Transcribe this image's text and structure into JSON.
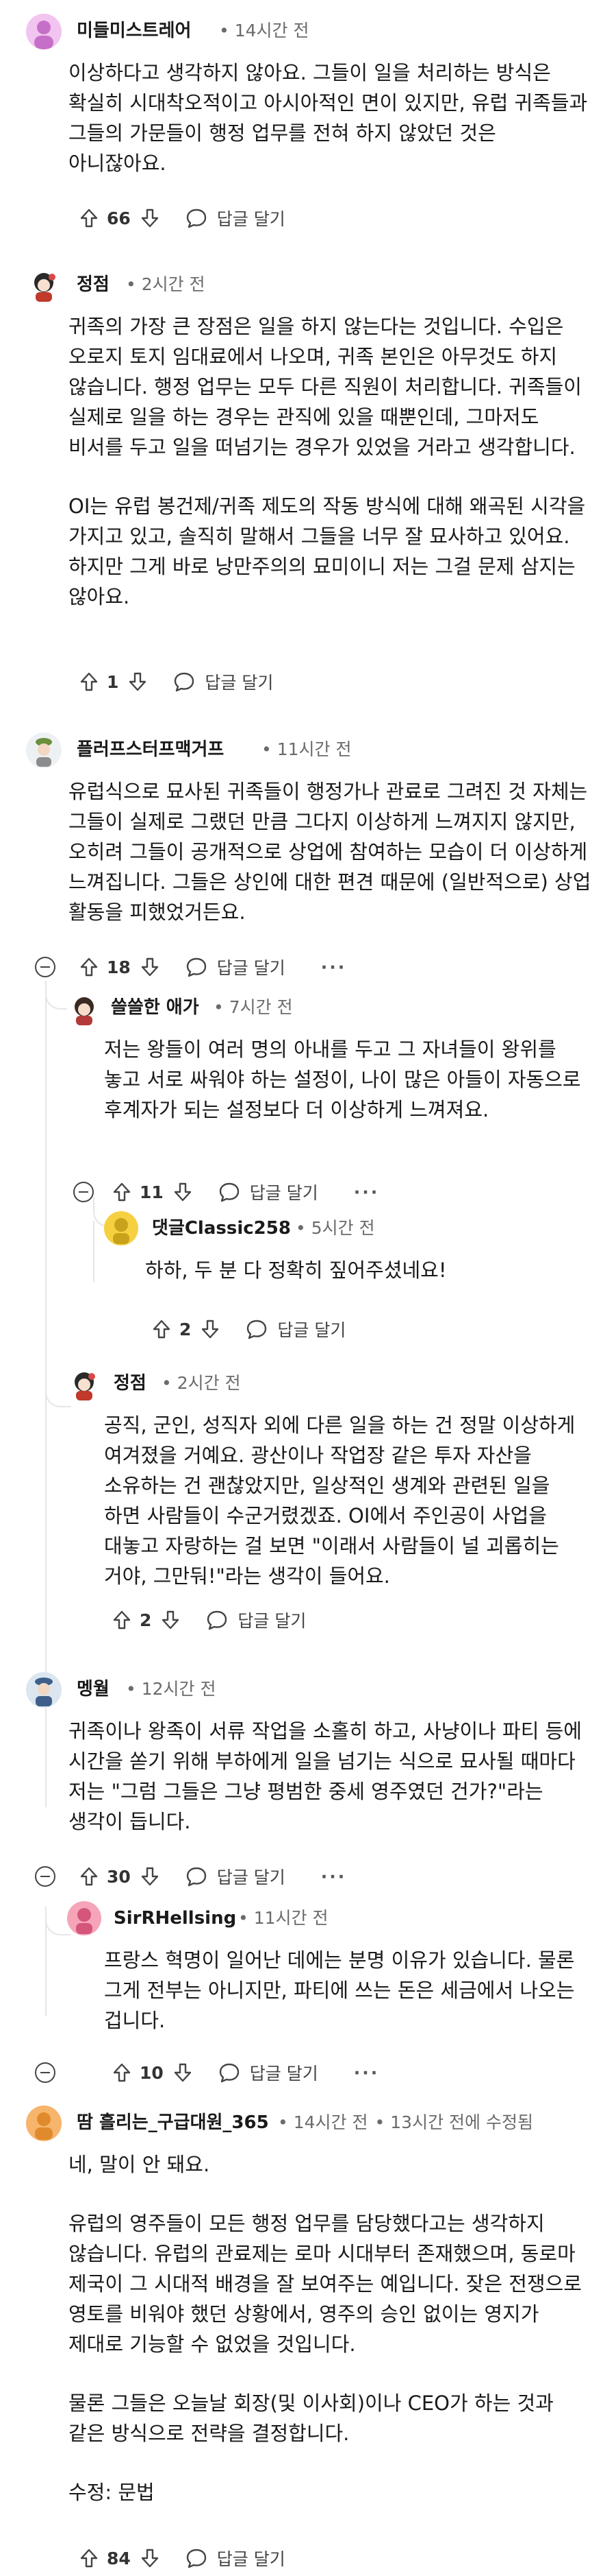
{
  "comments": [
    {
      "username": "미들미스트레어",
      "time": "14시간 전",
      "body": [
        "이상하다고 생각하지 않아요. 그들이 일을 처리하는 방식은 확실히 시대착오적이고 아시아적인 면이 있지만, 유럽 귀족들과 그들의 가문들이 행정 업무를 전혀 하지 않았던 것은 아니잖아요."
      ],
      "votes": "66",
      "reply_label": "답글 달기"
    },
    {
      "username": "정점",
      "time": "2시간 전",
      "body": [
        "귀족의 가장 큰 장점은 일을 하지 않는다는 것입니다. 수입은 오로지 토지 임대료에서 나오며, 귀족 본인은 아무것도 하지 않습니다. 행정 업무는 모두 다른 직원이 처리합니다. 귀족들이 실제로 일을 하는 경우는 관직에 있을 때뿐인데, 그마저도 비서를 두고 일을 떠넘기는 경우가 있었을 거라고 생각합니다.",
        "OI는 유럽 봉건제/귀족 제도의 작동 방식에 대해 왜곡된 시각을 가지고 있고, 솔직히 말해서 그들을 너무 잘 묘사하고 있어요. 하지만 그게 바로 낭만주의의 묘미이니 저는 그걸 문제 삼지는 않아요."
      ],
      "votes": "1",
      "reply_label": "답글 달기"
    },
    {
      "username": "플러프스터프맥거프",
      "time": "11시간 전",
      "body": [
        "유럽식으로 묘사된 귀족들이 행정가나 관료로 그려진 것 자체는 그들이 실제로 그랬던 만큼 그다지 이상하게 느껴지지 않지만, 오히려 그들이 공개적으로 상업에 참여하는 모습이 더 이상하게 느껴집니다. 그들은 상인에 대한 편견 때문에 (일반적으로) 상업 활동을 피했었거든요."
      ],
      "votes": "18",
      "reply_label": "답글 달기",
      "more": "···"
    },
    {
      "username": "쓸쓸한 애가",
      "time": "7시간 전",
      "body": [
        "저는 왕들이 여러 명의 아내를 두고 그 자녀들이 왕위를 놓고 서로 싸워야 하는 설정이, 나이 많은 아들이 자동으로 후계자가 되는 설정보다 더 이상하게 느껴져요."
      ],
      "votes": "11",
      "reply_label": "답글 달기",
      "more": "···"
    },
    {
      "username": "댓글Classic258",
      "time": "5시간 전",
      "body": [
        "하하, 두 분 다 정확히 짚어주셨네요!"
      ],
      "votes": "2",
      "reply_label": "답글 달기"
    },
    {
      "username": "정점",
      "time": "2시간 전",
      "body": [
        "공직, 군인, 성직자 외에 다른 일을 하는 건 정말 이상하게 여겨졌을 거예요. 광산이나 작업장 같은 투자 자산을 소유하는 건 괜찮았지만, 일상적인 생계와 관련된 일을 하면 사람들이 수군거렸겠죠. OI에서 주인공이 사업을 대놓고 자랑하는 걸 보면 \"이래서 사람들이 널 괴롭히는 거야, 그만둬!\"라는 생각이 들어요."
      ],
      "votes": "2",
      "reply_label": "답글 달기"
    },
    {
      "username": "멩월",
      "time": "12시간 전",
      "body": [
        "귀족이나 왕족이 서류 작업을 소홀히 하고, 사냥이나 파티 등에 시간을 쏟기 위해 부하에게 일을 넘기는 식으로 묘사될 때마다 저는 \"그럼 그들은 그냥 평범한 중세 영주였던 건가?\"라는 생각이 듭니다."
      ],
      "votes": "30",
      "reply_label": "답글 달기",
      "more": "···"
    },
    {
      "username": "SirRHellsing",
      "time": "11시간 전",
      "body": [
        "프랑스 혁명이 일어난 데에는 분명 이유가 있습니다. 물론 그게 전부는 아니지만, 파티에 쓰는 돈은 세금에서 나오는 겁니다."
      ],
      "votes": "10",
      "reply_label": "답글 달기",
      "more": "···"
    },
    {
      "username": "땀 흘리는_구급대원_365",
      "time": "14시간 전",
      "edited": "13시간 전에 수정됨",
      "body": [
        "네, 말이 안 돼요.",
        "유럽의 영주들이 모든 행정 업무를 담당했다고는 생각하지 않습니다. 유럽의 관료제는 로마 시대부터 존재했으며, 동로마 제국이 그 시대적 배경을 잘 보여주는 예입니다. 잦은 전쟁으로 영토를 비워야 했던 상황에서, 영주의 승인 없이는 영지가 제대로 기능할 수 없었을 것입니다.",
        "물론 그들은 오늘날 회장(및 이사회)이나 CEO가 하는 것과 같은 방식으로 전략을 결정합니다.",
        "수정: 문법"
      ],
      "votes": "84",
      "reply_label": "답글 달기"
    }
  ]
}
